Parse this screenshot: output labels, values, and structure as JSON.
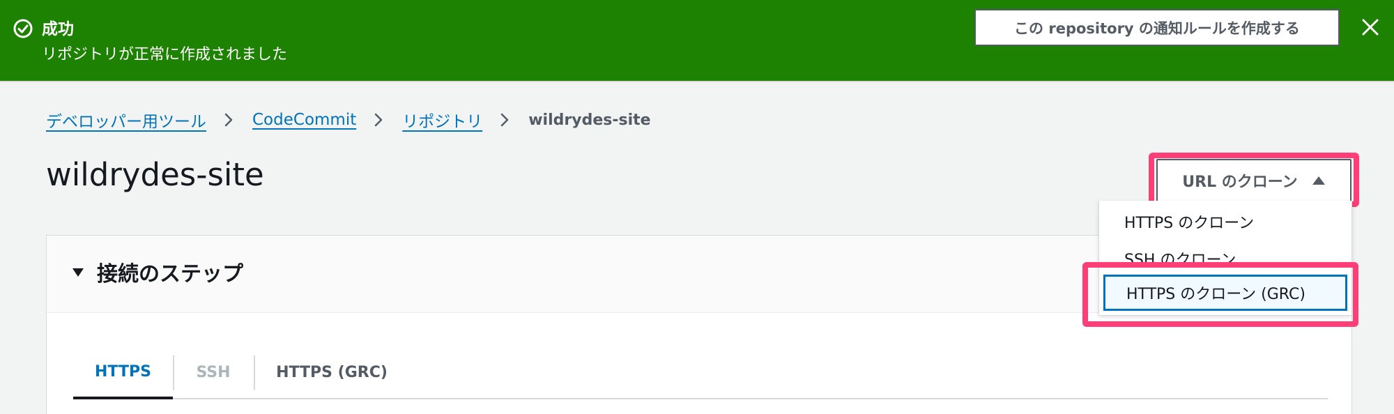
{
  "banner": {
    "title": "成功",
    "message": "リポジトリが正常に作成されました",
    "action_label": "この repository の通知ルールを作成する",
    "status_icon": "check-circle-icon",
    "close_icon": "close-icon",
    "background_color": "#1d8102"
  },
  "breadcrumb": {
    "items": [
      {
        "label": "デベロッパー用ツール"
      },
      {
        "label": "CodeCommit"
      },
      {
        "label": "リポジトリ"
      }
    ],
    "current": "wildrydes-site"
  },
  "page": {
    "title": "wildrydes-site"
  },
  "clone_button": {
    "label": "URL のクローン",
    "icon": "caret-up-icon"
  },
  "clone_menu": {
    "items": [
      {
        "label": "HTTPS のクローン"
      },
      {
        "label": "SSH のクローン"
      },
      {
        "label": "HTTPS のクローン (GRC)"
      }
    ],
    "focused_index": 2
  },
  "steps_panel": {
    "title": "接続のステップ",
    "expanded": true,
    "tabs": [
      {
        "label": "HTTPS",
        "state": "active"
      },
      {
        "label": "SSH",
        "state": "disabled"
      },
      {
        "label": "HTTPS (GRC)",
        "state": "normal"
      }
    ]
  },
  "colors": {
    "link": "#0073bb",
    "highlight": "#ff3d77",
    "success": "#1d8102"
  }
}
